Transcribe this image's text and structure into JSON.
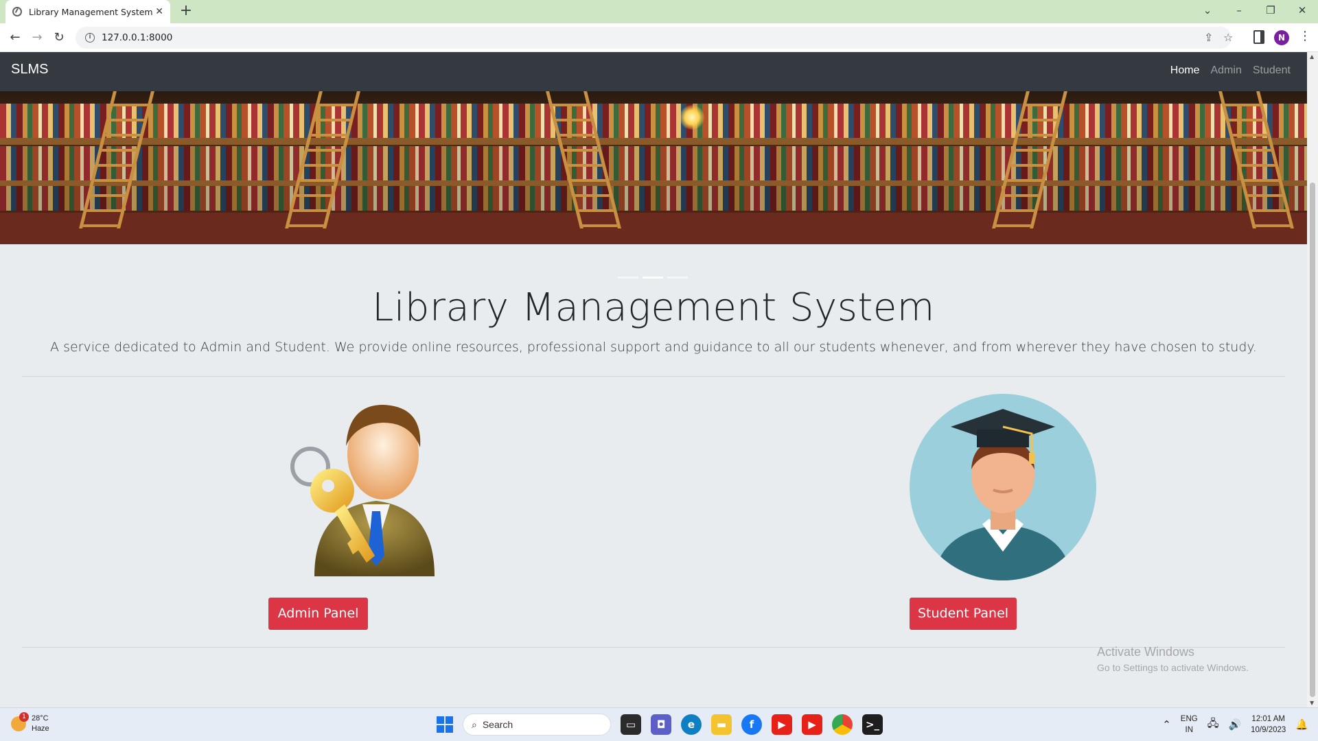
{
  "browser": {
    "tab_title": "Library Management System",
    "tab_close": "✕",
    "new_tab": "+",
    "url": "127.0.0.1:8000",
    "profile_initial": "N"
  },
  "navbar": {
    "brand": "SLMS",
    "links": [
      "Home",
      "Admin",
      "Student"
    ],
    "active_link": "Home"
  },
  "hero": {
    "slides": 3,
    "active_slide": 2
  },
  "jumbotron": {
    "title": "Library Management System",
    "lead": "A service dedicated to Admin and Student. We provide online resources, professional support and guidance to all our students whenever, and from wherever they have chosen to study."
  },
  "panels": {
    "admin_button": "Admin Panel",
    "student_button": "Student Panel"
  },
  "watermark": {
    "title": "Activate Windows",
    "subtitle": "Go to Settings to activate Windows."
  },
  "taskbar": {
    "weather_temp": "28°C",
    "weather_desc": "Haze",
    "weather_badge": "1",
    "search_label": "Search",
    "lang_1": "ENG",
    "lang_2": "IN",
    "time": "12:01 AM",
    "date": "10/9/2023"
  },
  "colors": {
    "navbar_bg": "#343a40",
    "button_red": "#dc3545",
    "page_bg": "#e9ecef"
  }
}
